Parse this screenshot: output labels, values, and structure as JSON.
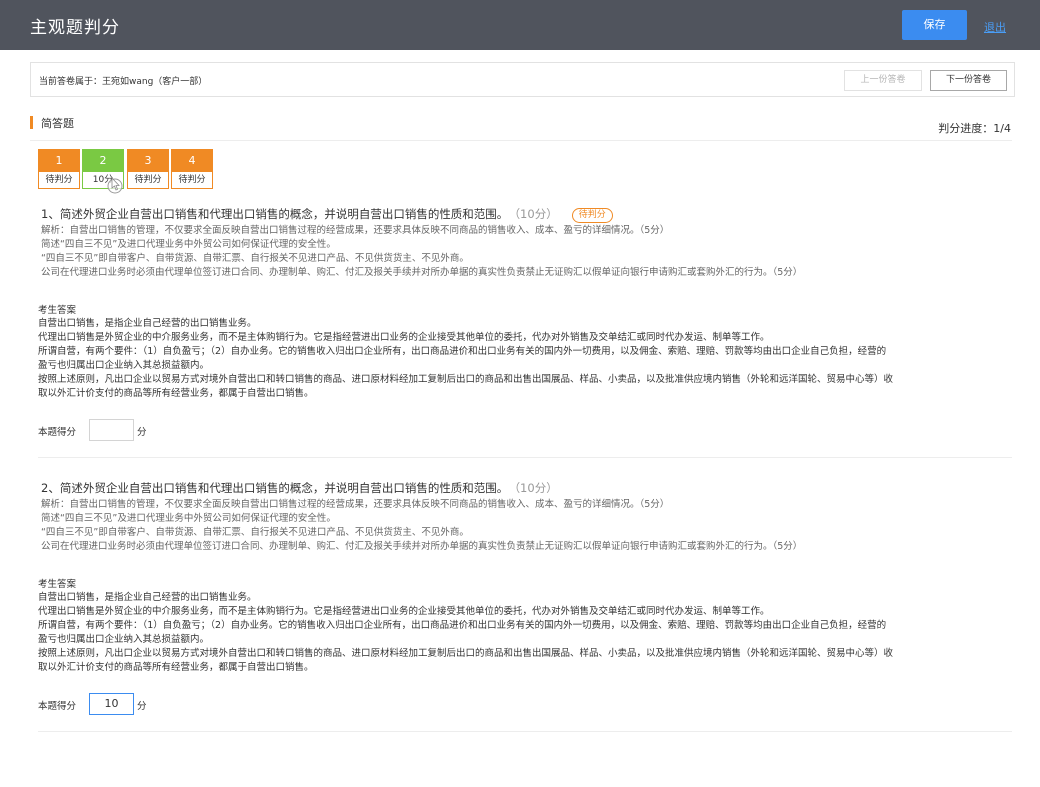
{
  "header": {
    "title": "主观题判分",
    "save_label": "保存",
    "exit_label": "退出"
  },
  "infobar": {
    "owner_text": "当前答卷属于：王宛如wang（客户一部）",
    "prev_label": "上一份答卷",
    "next_label": "下一份答卷"
  },
  "section": {
    "name": "简答题",
    "progress": "判分进度：1/4"
  },
  "question_nav": [
    {
      "number": "1",
      "status": "待判分",
      "state": "pending"
    },
    {
      "number": "2",
      "status": "10分",
      "state": "done"
    },
    {
      "number": "3",
      "status": "待判分",
      "state": "pending"
    },
    {
      "number": "4",
      "status": "待判分",
      "state": "pending"
    }
  ],
  "questions": [
    {
      "title": "1、简述外贸企业自营出口销售和代理出口销售的概念，并说明自营出口销售的性质和范围。",
      "score": "（10分）",
      "tag": "待判分",
      "analysis": [
        "解析：自营出口销售的管理，不仅要求全面反映自营出口销售过程的经营成果，还要求具体反映不同商品的销售收入、成本、盈亏的详细情况。（5分）",
        "简述“四自三不见”及进口代理业务中外贸公司如何保证代理的安全性。",
        "“四自三不见”即自带客户、自带货源、自带汇票、自行报关不见进口产品、不见供货货主、不见外商。",
        "公司在代理进口业务时必须由代理单位签订进口合同、办理制单、购汇、付汇及报关手续并对所办单据的真实性负责禁止无证购汇以假单证向银行申请购汇或套购外汇的行为。（5分）"
      ],
      "answer_heading": "考生答案",
      "answer": [
        "自营出口销售，是指企业自己经营的出口销售业务。",
        "代理出口销售是外贸企业的中介服务业务，而不是主体购销行为。它是指经营进出口业务的企业接受其他单位的委托，代办对外销售及交单结汇或同时代办发运、制单等工作。",
        "所谓自营，有两个要件：（1）自负盈亏；（2）自办业务。它的销售收入归出口企业所有，出口商品进价和出口业务有关的国内外一切费用，以及佣金、索赔、理赔、罚款等均由出口企业自己负担，经营的",
        "盈亏也归属出口企业纳入其总损益额内。",
        "按照上述原则，凡出口企业以贸易方式对境外自营出口和转口销售的商品、进口原材料经加工复制后出口的商品和出售出国展品、样品、小卖品，以及批准供应境内销售（外轮和远洋国轮、贸易中心等）收",
        "取以外汇计价支付的商品等所有经营业务，都属于自营出口销售。"
      ],
      "score_label": "本题得分",
      "score_value": "",
      "score_unit": "分"
    },
    {
      "title": "2、简述外贸企业自营出口销售和代理出口销售的概念，并说明自营出口销售的性质和范围。",
      "score": "（10分）",
      "tag": "",
      "analysis": [
        "解析：自营出口销售的管理，不仅要求全面反映自营出口销售过程的经营成果，还要求具体反映不同商品的销售收入、成本、盈亏的详细情况。（5分）",
        "简述“四自三不见”及进口代理业务中外贸公司如何保证代理的安全性。",
        "“四自三不见”即自带客户、自带货源、自带汇票、自行报关不见进口产品、不见供货货主、不见外商。",
        "公司在代理进口业务时必须由代理单位签订进口合同、办理制单、购汇、付汇及报关手续并对所办单据的真实性负责禁止无证购汇以假单证向银行申请购汇或套购外汇的行为。（5分）"
      ],
      "answer_heading": "考生答案",
      "answer": [
        "自营出口销售，是指企业自己经营的出口销售业务。",
        "代理出口销售是外贸企业的中介服务业务，而不是主体购销行为。它是指经营进出口业务的企业接受其他单位的委托，代办对外销售及交单结汇或同时代办发运、制单等工作。",
        "所谓自营，有两个要件：（1）自负盈亏；（2）自办业务。它的销售收入归出口企业所有，出口商品进价和出口业务有关的国内外一切费用，以及佣金、索赔、理赔、罚款等均由出口企业自己负担，经营的",
        "盈亏也归属出口企业纳入其总损益额内。",
        "按照上述原则，凡出口企业以贸易方式对境外自营出口和转口销售的商品、进口原材料经加工复制后出口的商品和出售出国展品、样品、小卖品，以及批准供应境内销售（外轮和远洋国轮、贸易中心等）收",
        "取以外汇计价支付的商品等所有经营业务，都属于自营出口销售。"
      ],
      "score_label": "本题得分",
      "score_value": "10",
      "score_unit": "分"
    }
  ],
  "colors": {
    "header_bg": "#50545d",
    "primary": "#3b8cf0",
    "pending": "#f08a24",
    "done": "#7ac943"
  }
}
